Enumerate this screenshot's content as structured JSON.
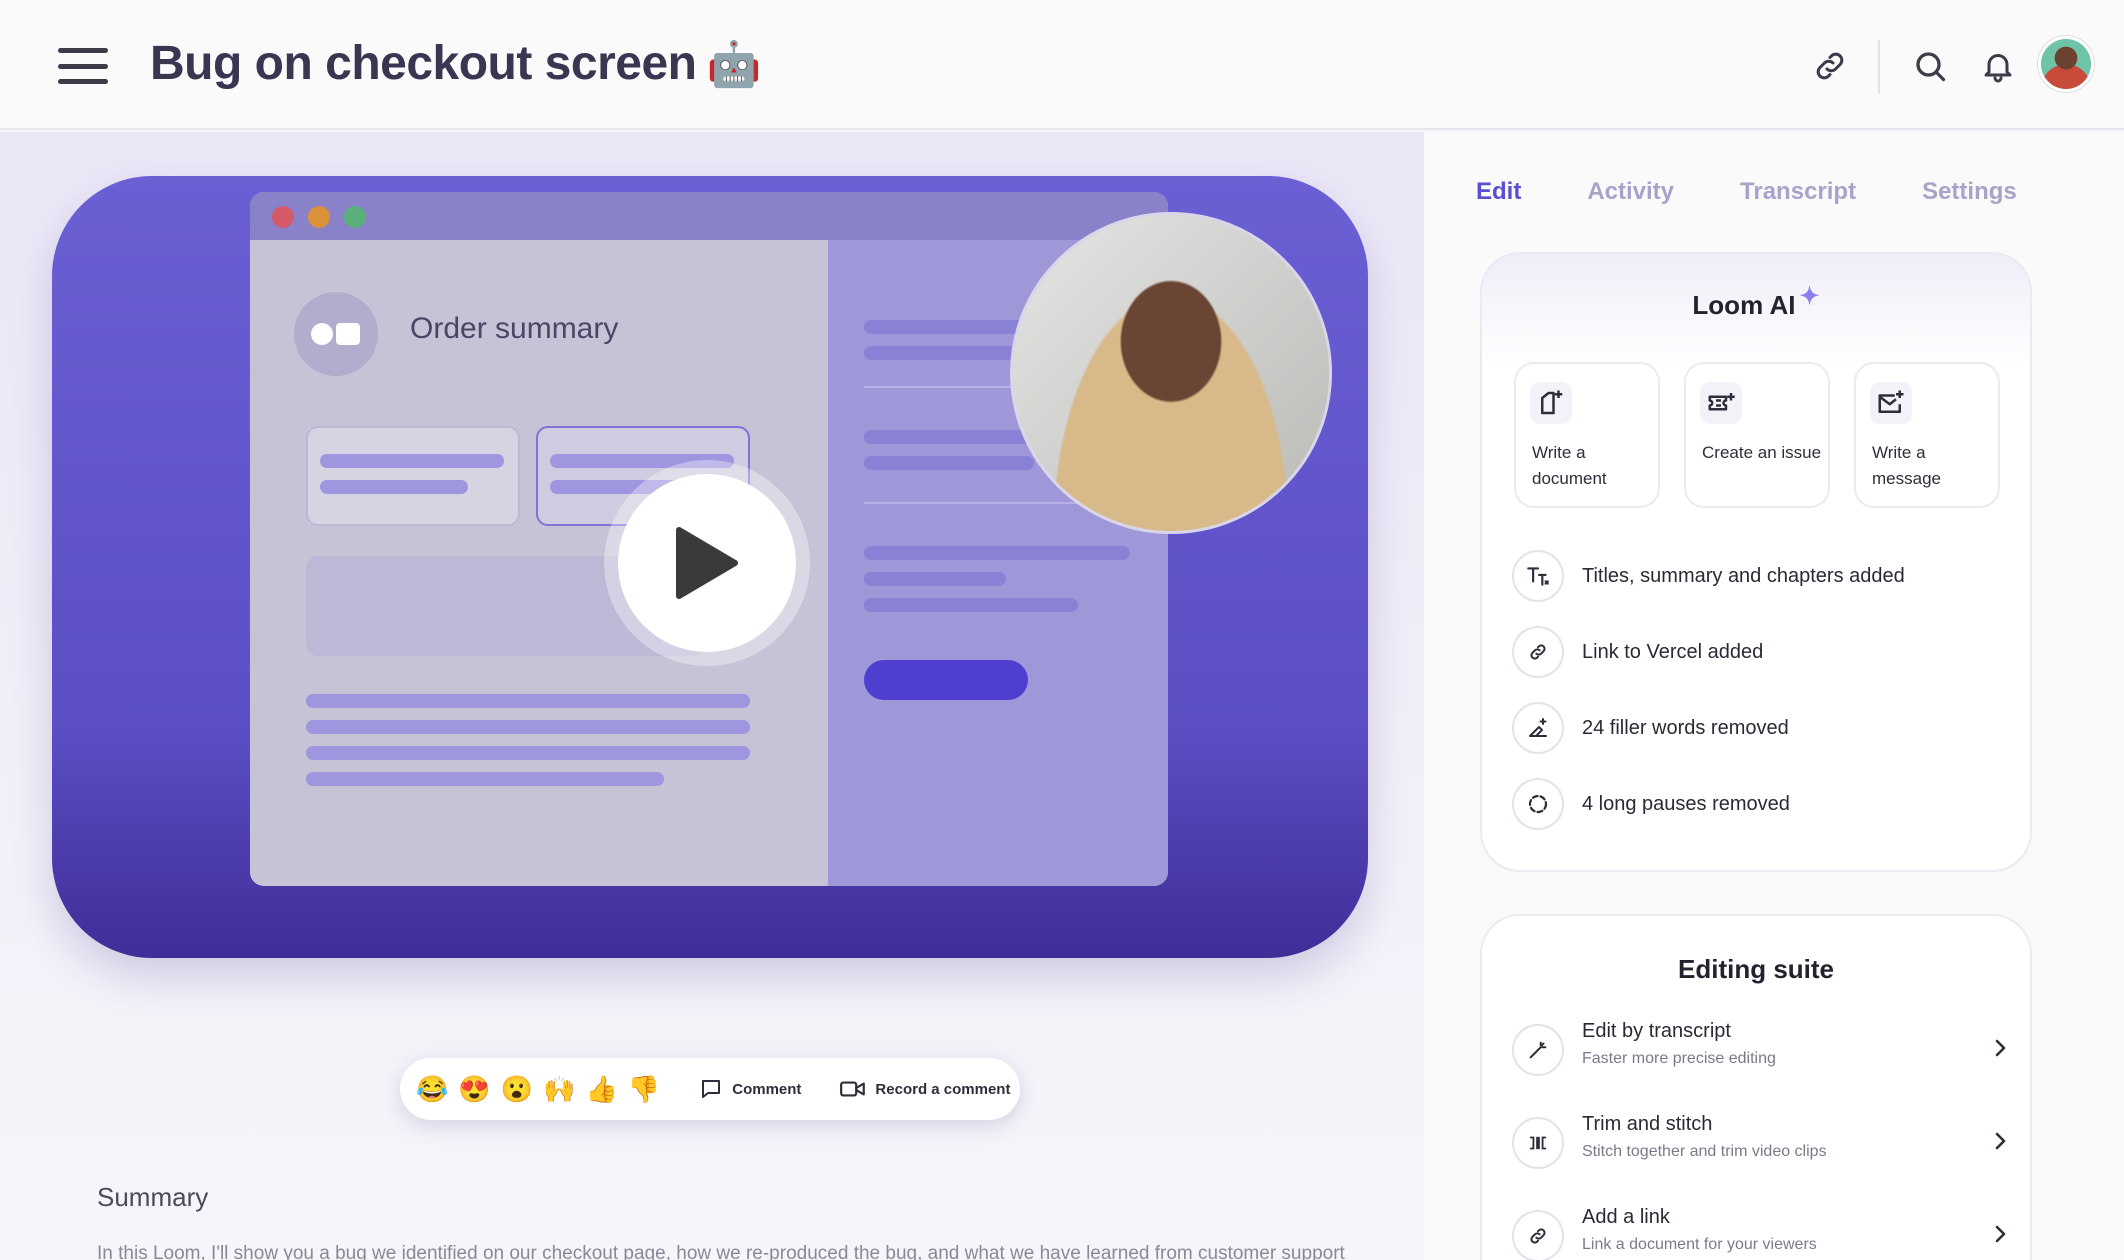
{
  "header": {
    "title": "Bug on checkout screen",
    "title_emoji": "🤖"
  },
  "video": {
    "mock_title": "Order summary"
  },
  "reactions": {
    "emojis": [
      "😂",
      "😍",
      "😮",
      "🙌",
      "👍",
      "👎"
    ],
    "comment_label": "Comment",
    "record_label": "Record a comment"
  },
  "summary": {
    "heading": "Summary",
    "text": "In this Loom, I'll show you a bug we identified on our checkout page, how we re-produced the bug, and what we have learned from customer support about the impact to our customers. This Loom should have all of the info you need to diagnose the problem."
  },
  "tabs": [
    {
      "label": "Edit",
      "active": true
    },
    {
      "label": "Activity",
      "active": false
    },
    {
      "label": "Transcript",
      "active": false
    },
    {
      "label": "Settings",
      "active": false
    }
  ],
  "loom_ai": {
    "title": "Loom AI",
    "actions": [
      {
        "label": "Write a document",
        "icon": "document-plus-icon"
      },
      {
        "label": "Create an issue",
        "icon": "ticket-plus-icon"
      },
      {
        "label": "Write a message",
        "icon": "mail-plus-icon"
      }
    ],
    "features": [
      {
        "label": "Titles, summary and chapters added",
        "icon": "text-sparkle-icon"
      },
      {
        "label": "Link to Vercel added",
        "icon": "link-icon"
      },
      {
        "label": "24 filler words removed",
        "icon": "eraser-icon"
      },
      {
        "label": "4 long pauses removed",
        "icon": "pause-circle-icon"
      }
    ]
  },
  "editing_suite": {
    "title": "Editing suite",
    "items": [
      {
        "title": "Edit by transcript",
        "subtitle": "Faster more precise editing",
        "icon": "magic-wand-icon"
      },
      {
        "title": "Trim and stitch",
        "subtitle": "Stitch together and trim video clips",
        "icon": "trim-icon"
      },
      {
        "title": "Add a link",
        "subtitle": "Link a document for your viewers",
        "icon": "link-icon"
      }
    ]
  },
  "colors": {
    "accent": "#5a4fd1",
    "player_bg": "#6b5fd4"
  }
}
